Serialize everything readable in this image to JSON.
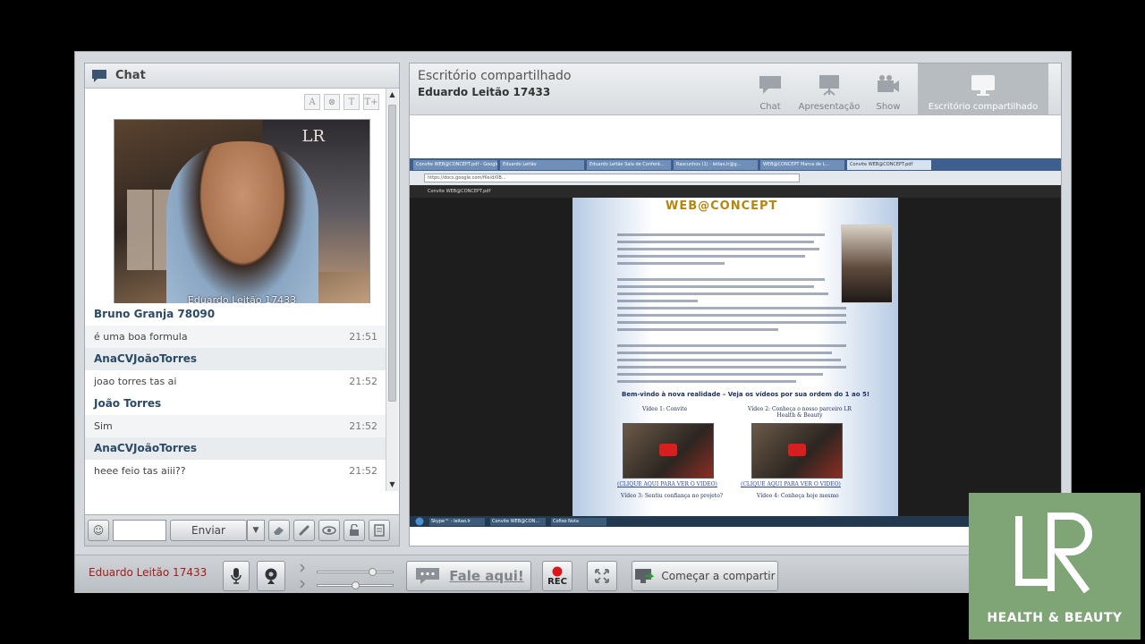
{
  "chat": {
    "title": "Chat",
    "tools": [
      "A",
      "⊗",
      "T",
      "T+"
    ],
    "video_caption": "Eduardo Leitão 17433",
    "messages": [
      {
        "name": "Bruno Granja 78090",
        "text": "é uma boa formula",
        "time": "21:51"
      },
      {
        "name": "AnaCVJoãoTorres",
        "text": "joao torres tas ai",
        "time": "21:52"
      },
      {
        "name": "João Torres",
        "text": "Sim",
        "time": "21:52"
      },
      {
        "name": "AnaCVJoãoTorres",
        "text": "heee feio tas aiii??",
        "time": "21:52"
      }
    ],
    "input_value": "",
    "send_label": "Enviar"
  },
  "share": {
    "title": "Escritório compartilhado",
    "subtitle": "Eduardo Leitão 17433",
    "tabs": [
      {
        "label": "Chat",
        "icon": "chat-icon"
      },
      {
        "label": "Apresentação",
        "icon": "presentation-icon"
      },
      {
        "label": "Show",
        "icon": "camera-icon"
      },
      {
        "label": "Escritório compartilhado",
        "icon": "monitor-icon",
        "active": true
      }
    ],
    "screen": {
      "browser_tabs": [
        "Convite WEB@CONCEPT.pdf - Google Drive",
        "Eduardo Leitão",
        "Eduardo Leitão Sala de Conferê...",
        "Rascunhos (1) - leitao.lr@g...",
        "WEB@CONCEPT Marca de L...",
        "Convite WEB@CONCEPT.pdf"
      ],
      "url": "https://docs.google.com/file/d/0B...",
      "pdf_name": "Convite WEB@CONCEPT.pdf",
      "brand": "WEB@CONCEPT",
      "headline": "Bem-vindo à nova realidade – Veja os vídeos por sua ordem do 1 ao 5!",
      "video1_label": "Vídeo 1: Convite",
      "video2_label": "Vídeo 2: Conheça o nosso parceiro LR Health & Beauty",
      "link1": "(CLIQUE AQUI PARA VER O VIDEO)",
      "link2": "(CLIQUE AQUI PARA VER O VIDEO)",
      "video3_label": "Vídeo 3: Sentiu confiança no projeto?",
      "video4_label": "Vídeo 4: Conheça hoje mesmo",
      "taskbar": [
        "Skype™ - leitao.lr",
        "Convite WEB@CON...",
        "Cofixo Nota"
      ]
    }
  },
  "bottom": {
    "user_name": "Eduardo Leitão 17433",
    "talk_label": "Fale aqui!",
    "rec_label": "REC",
    "share_label": "Começar a compartir",
    "volume_level": 0.72,
    "mic_level": 0.5
  },
  "logo": {
    "tagline": "HEALTH & BEAUTY",
    "brand_color": "#7fa476"
  }
}
